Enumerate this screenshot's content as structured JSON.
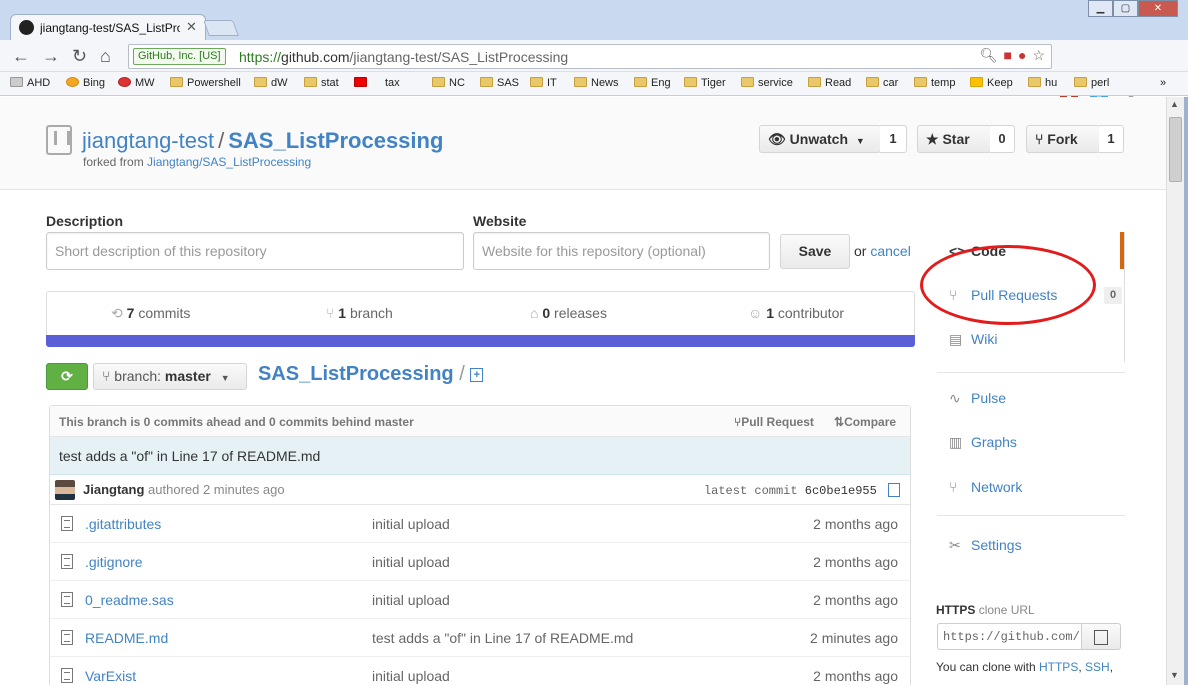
{
  "browser": {
    "tab_title": "jiangtang-test/SAS_ListProce",
    "ev_badge": "GitHub, Inc. [US]",
    "url_scheme": "https://",
    "url_host": "github.com",
    "url_path": "/jiangtang-test/SAS_ListProcessing",
    "bookmarks": [
      "AHD",
      "Bing",
      "MW",
      "Powershell",
      "dW",
      "stat",
      "tax",
      "NC",
      "SAS",
      "IT",
      "News",
      "Eng",
      "Tiger",
      "service",
      "Read",
      "car",
      "temp",
      "Keep",
      "hu",
      "perl"
    ],
    "bookmarks_more": "»"
  },
  "repo": {
    "owner": "jiangtang-test",
    "name": "SAS_ListProcessing",
    "forked_prefix": "forked from",
    "forked_from": "Jiangtang/SAS_ListProcessing",
    "unwatch_label": "Unwatch",
    "unwatch_count": "1",
    "star_label": "Star",
    "star_count": "0",
    "fork_label": "Fork",
    "fork_count": "1"
  },
  "edit": {
    "description_label": "Description",
    "description_placeholder": "Short description of this repository",
    "website_label": "Website",
    "website_placeholder": "Website for this repository (optional)",
    "save_label": "Save",
    "or_text": "or",
    "cancel_label": "cancel"
  },
  "summary": {
    "commits_num": "7",
    "commits_label": "commits",
    "branches_num": "1",
    "branches_label": "branch",
    "releases_num": "0",
    "releases_label": "releases",
    "contributors_num": "1",
    "contributors_label": "contributor",
    "language_color": "#5b5fd6"
  },
  "branch": {
    "prefix": "branch:",
    "name": "master",
    "path_repo": "SAS_ListProcessing",
    "path_sep": "/"
  },
  "files": {
    "ahead_text": "This branch is 0 commits ahead and 0 commits behind master",
    "pull_request_link": "Pull Request",
    "compare_link": "Compare",
    "latest_message": "test adds a \"of\" in Line 17 of README.md",
    "author": "Jiangtang",
    "authored_text": "authored 2 minutes ago",
    "latest_commit_label": "latest commit",
    "latest_commit_sha": "6c0be1e955",
    "rows": [
      {
        "name": ".gitattributes",
        "message": "initial upload",
        "age": "2 months ago"
      },
      {
        "name": ".gitignore",
        "message": "initial upload",
        "age": "2 months ago"
      },
      {
        "name": "0_readme.sas",
        "message": "initial upload",
        "age": "2 months ago"
      },
      {
        "name": "README.md",
        "message": "test adds a \"of\" in Line 17 of README.md",
        "age": "2 minutes ago"
      },
      {
        "name": "VarExist",
        "message": "initial upload",
        "age": "2 months ago"
      }
    ]
  },
  "sidebar": {
    "code": "Code",
    "pull_requests": "Pull Requests",
    "pull_requests_count": "0",
    "wiki": "Wiki",
    "pulse": "Pulse",
    "graphs": "Graphs",
    "network": "Network",
    "settings": "Settings",
    "clone_title": "HTTPS",
    "clone_sub": "clone URL",
    "clone_value": "https://github.com/",
    "clone_note_prefix": "You can clone with",
    "clone_https": "HTTPS",
    "clone_ssh": "SSH"
  }
}
